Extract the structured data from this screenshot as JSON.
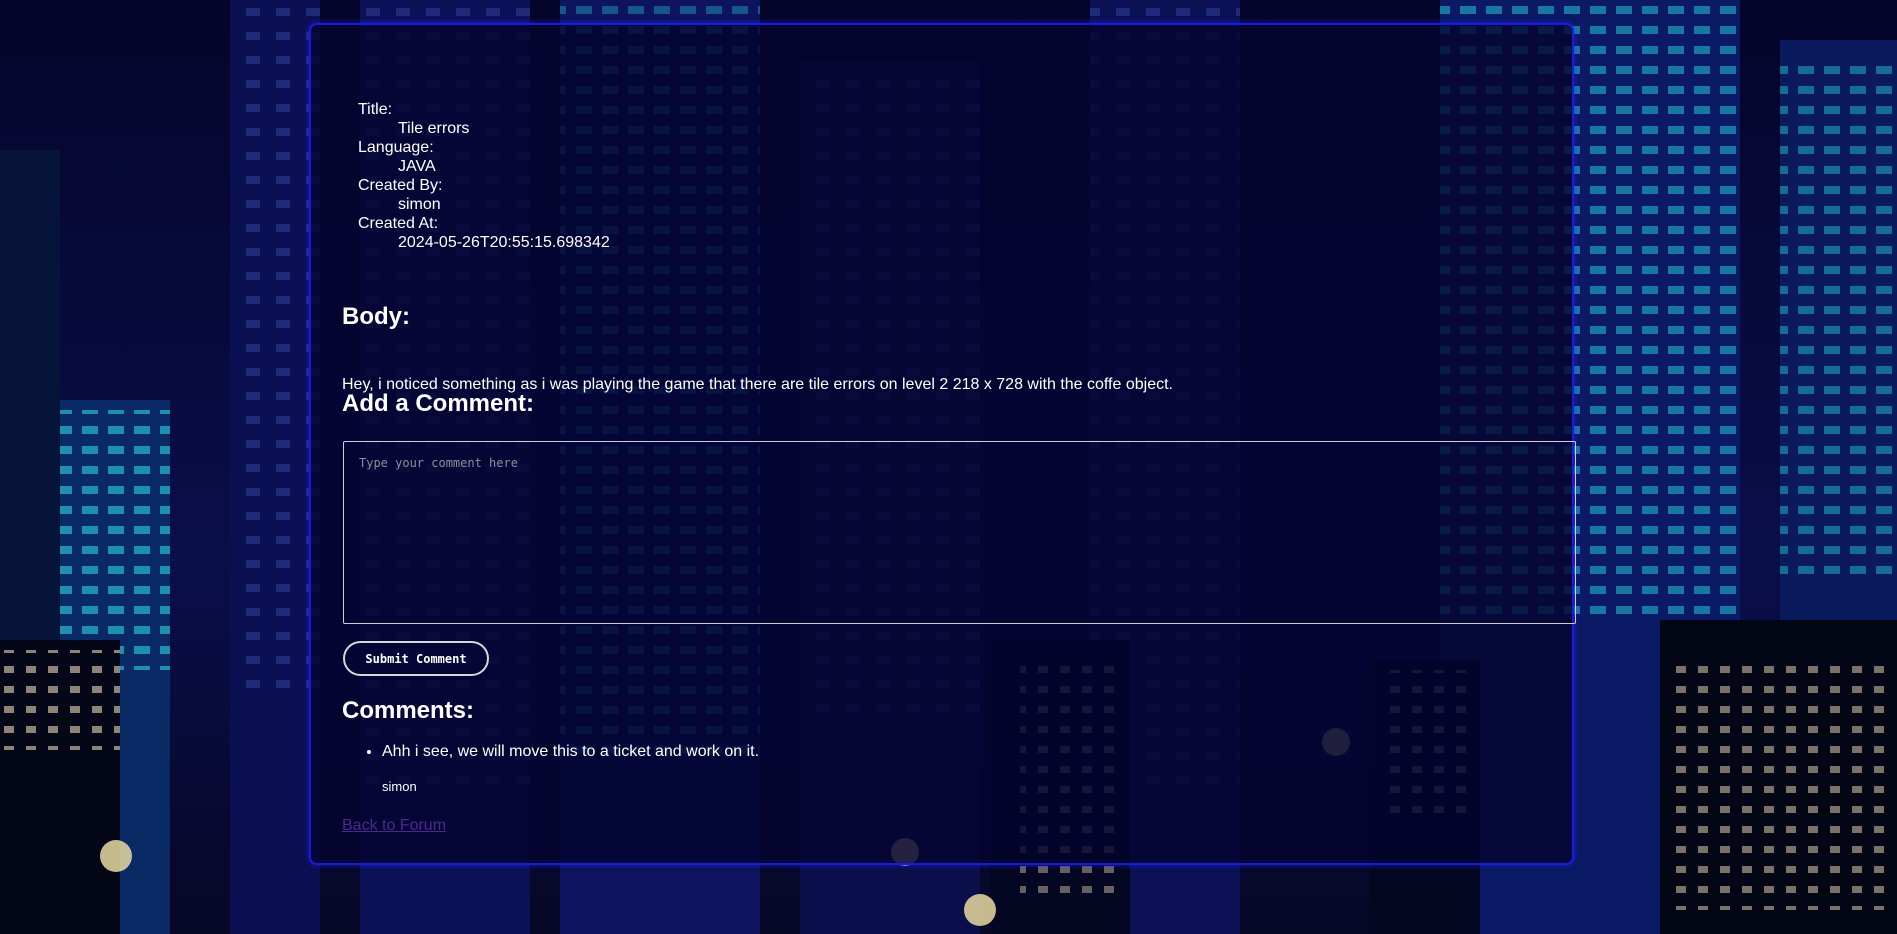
{
  "ticket": {
    "title_label": "Title:",
    "title_value": "Tile errors",
    "language_label": "Language:",
    "language_value": "JAVA",
    "created_by_label": "Created By:",
    "created_by_value": "simon",
    "created_at_label": "Created At:",
    "created_at_value": "2024-05-26T20:55:15.698342"
  },
  "body": {
    "heading": "Body:",
    "text": "Hey, i noticed something as i was playing the game that there are tile errors on level 2 218 x 728 with the coffe object."
  },
  "add_comment": {
    "heading": "Add a Comment:",
    "placeholder": "Type your comment here",
    "submit_label": "Submit Comment"
  },
  "comments": {
    "heading": "Comments:",
    "items": [
      {
        "text": "Ahh i see, we will move this to a ticket and work on it.",
        "author": "simon"
      }
    ]
  },
  "back_link": "Back to Forum",
  "colors": {
    "panel_border": "#1a1ae6",
    "background": "#03031f",
    "link": "#4b2a8e"
  }
}
